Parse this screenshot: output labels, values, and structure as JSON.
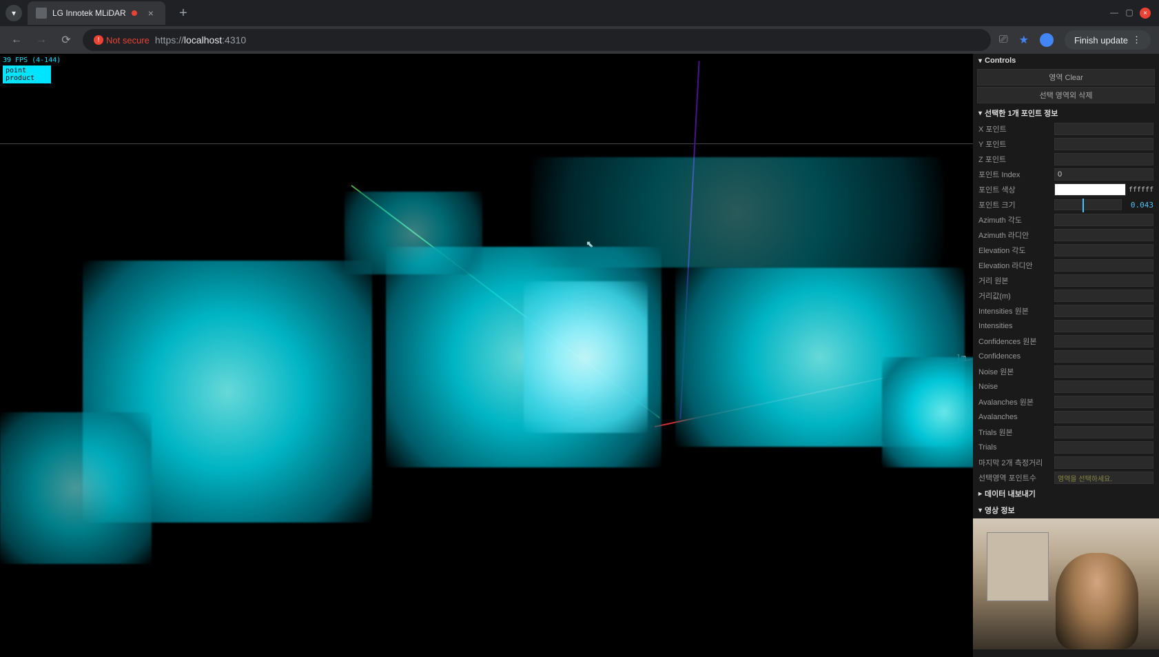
{
  "browser": {
    "tab_title": "LG Innotek MLiDAR",
    "not_secure_label": "Not secure",
    "url_prefix": "https://",
    "url_host": "localhost",
    "url_port": ":4310",
    "finish_update_label": "Finish update"
  },
  "viewport": {
    "fps_text": "39 FPS (4-144)",
    "fps_label": "point product",
    "scale_label": "1m"
  },
  "controls": {
    "header": "Controls",
    "buttons": {
      "area_clear": "영역 Clear",
      "area_delete": "선택 영역외 삭제"
    },
    "point_info_header": "선택한 1개 포인트 정보",
    "rows": {
      "x_point": "X 포인트",
      "y_point": "Y 포인트",
      "z_point": "Z 포인트",
      "point_index": "포인트 Index",
      "point_index_value": "0",
      "point_color": "포인트 색상",
      "point_color_hex": "ffffff",
      "point_size": "포인트 크기",
      "point_size_value": "0.043",
      "azimuth_deg": "Azimuth 각도",
      "azimuth_rad": "Azimuth 라디안",
      "elevation_deg": "Elevation 각도",
      "elevation_rad": "Elevation 라디안",
      "distance_raw": "거리 원본",
      "distance_m": "거리값(m)",
      "intensities_raw": "Intensities 원본",
      "intensities": "Intensities",
      "confidences_raw": "Confidences 원본",
      "confidences": "Confidences",
      "noise_raw": "Noise 원본",
      "noise": "Noise",
      "avalanches_raw": "Avalanches 원본",
      "avalanches": "Avalanches",
      "trials_raw": "Trials 원본",
      "trials": "Trials",
      "last_two_distance": "마지막 2개 측정거리",
      "selected_point_count": "선택영역 포인트수",
      "selected_point_hint": "영역을 선택하세요."
    },
    "data_export_header": "데이터 내보내기",
    "video_info_header": "영상 정보"
  }
}
